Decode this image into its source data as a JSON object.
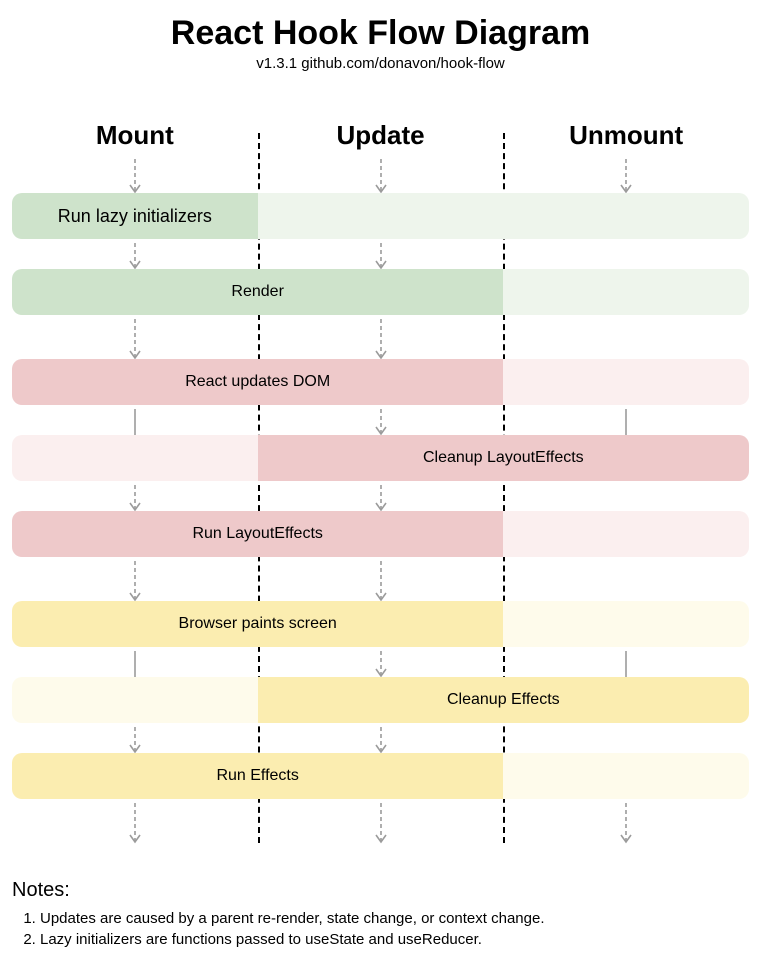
{
  "header": {
    "title": "React Hook Flow Diagram",
    "subtitle": "v1.3.1 github.com/donavon/hook-flow"
  },
  "columns": [
    "Mount",
    "Update",
    "Unmount"
  ],
  "colors": {
    "green_strong": "#cee3cb",
    "green_weak": "#eef5ec",
    "red_strong": "#eec9ca",
    "red_weak": "#fbefef",
    "yellow_strong": "#fbedb0",
    "yellow_weak": "#fefbeb"
  },
  "rows": [
    {
      "id": "lazy-init",
      "label": "Run lazy initializers",
      "label_col": 0,
      "colors": [
        "green_strong",
        "green_weak",
        "green_weak"
      ]
    },
    {
      "id": "render",
      "label": "Render",
      "label_col": 1,
      "colors": [
        "green_strong",
        "green_strong",
        "green_weak"
      ],
      "span_label_cols": [
        0,
        1
      ]
    },
    {
      "id": "spacer1",
      "spacer": true
    },
    {
      "id": "dom",
      "label": "React updates DOM",
      "label_col": 1,
      "colors": [
        "red_strong",
        "red_strong",
        "red_weak"
      ],
      "span_label_cols": [
        0,
        1
      ]
    },
    {
      "id": "cleanup-le",
      "label": "Cleanup LayoutEffects",
      "label_col": 1,
      "colors": [
        "red_weak",
        "red_strong",
        "red_strong"
      ],
      "span_label_cols": [
        1,
        2
      ]
    },
    {
      "id": "run-le",
      "label": "Run LayoutEffects",
      "label_col": 1,
      "colors": [
        "red_strong",
        "red_strong",
        "red_weak"
      ],
      "span_label_cols": [
        0,
        1
      ]
    },
    {
      "id": "spacer2",
      "spacer": true
    },
    {
      "id": "paint",
      "label": "Browser paints screen",
      "label_col": 1,
      "colors": [
        "yellow_strong",
        "yellow_strong",
        "yellow_weak"
      ],
      "span_label_cols": [
        0,
        1
      ]
    },
    {
      "id": "cleanup-e",
      "label": "Cleanup Effects",
      "label_col": 1,
      "colors": [
        "yellow_weak",
        "yellow_strong",
        "yellow_strong"
      ],
      "span_label_cols": [
        1,
        2
      ]
    },
    {
      "id": "run-e",
      "label": "Run Effects",
      "label_col": 1,
      "colors": [
        "yellow_strong",
        "yellow_strong",
        "yellow_weak"
      ],
      "span_label_cols": [
        0,
        1
      ]
    }
  ],
  "arrows_between": {
    "top": [
      true,
      true,
      true
    ],
    "after_lazy": [
      true,
      true,
      false
    ],
    "after_render": [
      true,
      true,
      false
    ],
    "after_dom": [
      false,
      true,
      true
    ],
    "after_cleanle": [
      true,
      true,
      false
    ],
    "after_runle": [
      true,
      true,
      false
    ],
    "after_paint": [
      false,
      true,
      true
    ],
    "after_cleane": [
      true,
      true,
      false
    ],
    "bottom": [
      true,
      true,
      true
    ]
  },
  "long_lines": {
    "mount_over_cleanle": true,
    "mount_over_cleane": true,
    "unmount_top": true,
    "unmount_mid": true
  },
  "notes": {
    "heading": "Notes:",
    "items": [
      "Updates are caused by a parent re-render, state change, or context change.",
      "Lazy initializers are functions passed to useState and useReducer."
    ]
  }
}
